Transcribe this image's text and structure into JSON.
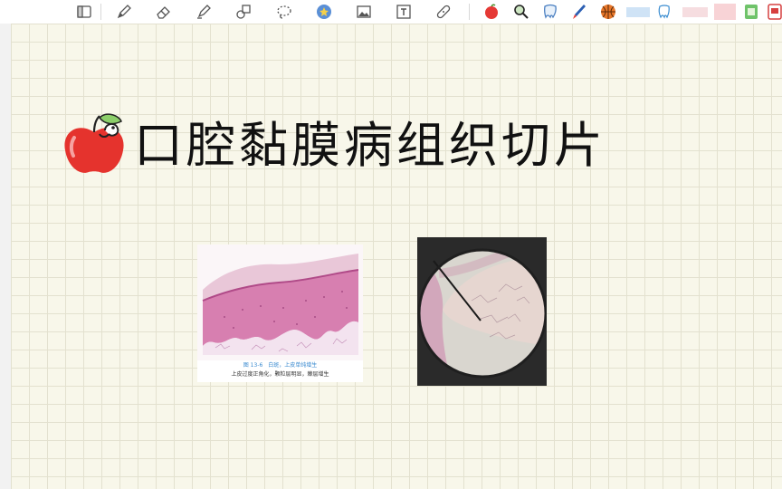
{
  "toolbar": {
    "tools": [
      {
        "name": "layout-icon"
      },
      {
        "name": "pen-icon"
      },
      {
        "name": "eraser-icon"
      },
      {
        "name": "highlighter-icon"
      },
      {
        "name": "shapes-icon"
      },
      {
        "name": "lasso-icon"
      },
      {
        "name": "sticker-icon"
      },
      {
        "name": "image-icon"
      },
      {
        "name": "text-icon"
      },
      {
        "name": "bandage-icon"
      }
    ],
    "stickers": [
      {
        "name": "apple-sticker-icon"
      },
      {
        "name": "magnifier-sticker-icon"
      },
      {
        "name": "tooth-sticker-icon"
      },
      {
        "name": "brush-sticker-icon"
      },
      {
        "name": "basketball-sticker-icon"
      },
      {
        "name": "blue-tape-sticker-icon"
      },
      {
        "name": "tooth-outline-sticker-icon"
      },
      {
        "name": "pink-tape-sticker-icon"
      },
      {
        "name": "pink-note-sticker-icon"
      },
      {
        "name": "green-card-sticker-icon"
      },
      {
        "name": "red-card-sticker-icon"
      }
    ]
  },
  "page": {
    "title": "口腔黏膜病组织切片"
  },
  "figure": {
    "caption_line1": "图 13-6　白斑，上皮单纯增生",
    "caption_line2": "上皮过度正角化，颗粒层明显，棘层增生"
  },
  "colors": {
    "canvas": "#f8f7ea",
    "grid": "#e3e1cf",
    "tissue_pink": "#d77fb0",
    "title_text": "#111111"
  }
}
